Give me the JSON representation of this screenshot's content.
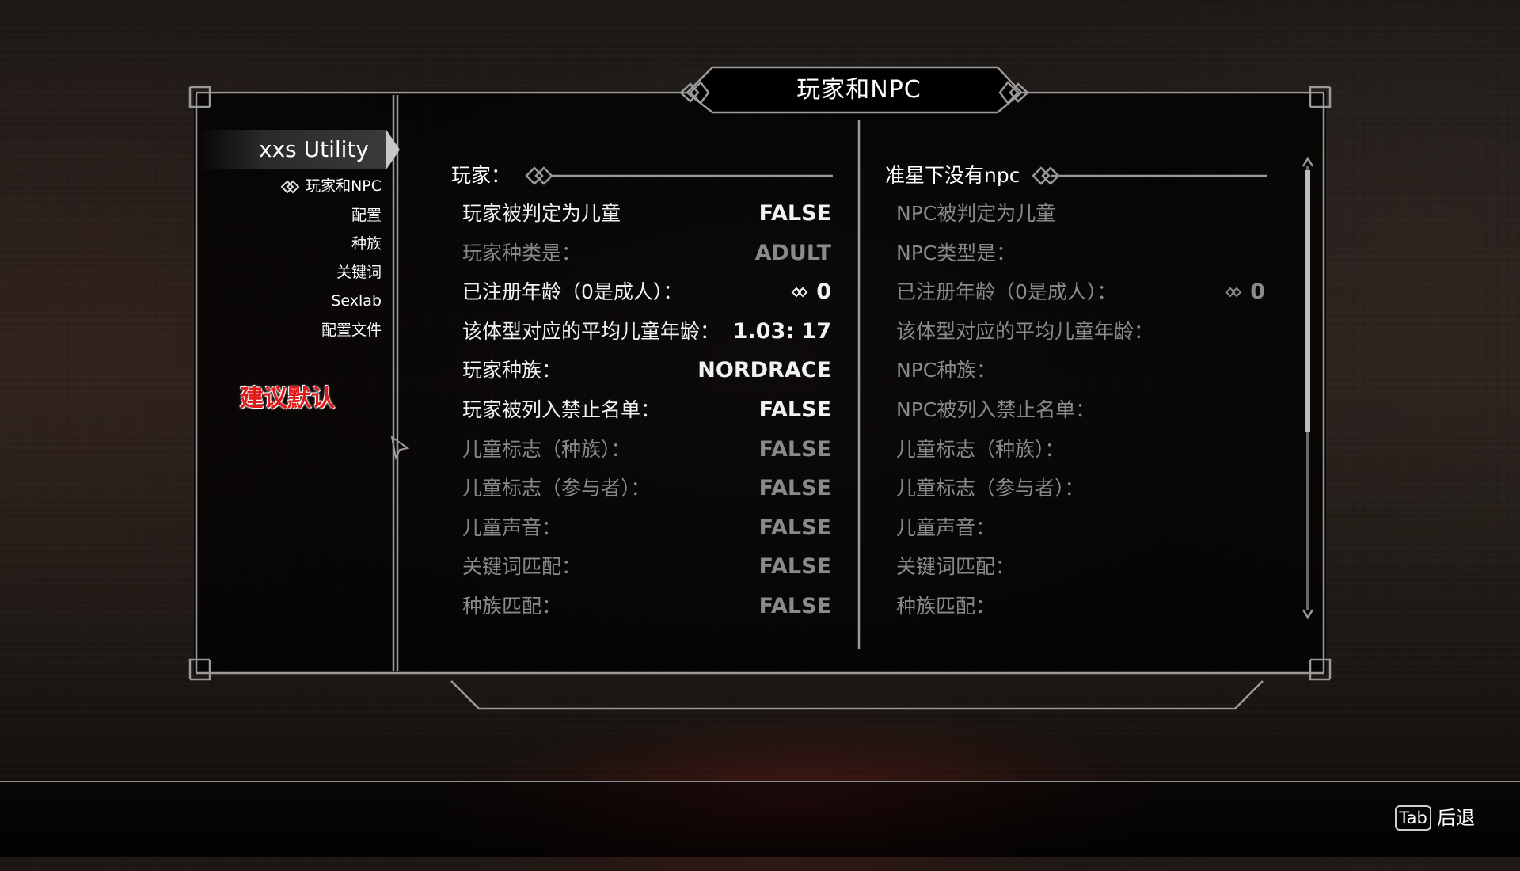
{
  "header": {
    "title": "玩家和NPC"
  },
  "sidebar": {
    "mod_title": "xxs Utility",
    "items": [
      {
        "label": "玩家和NPC",
        "selected": true
      },
      {
        "label": "配置"
      },
      {
        "label": "种族"
      },
      {
        "label": "关键词"
      },
      {
        "label": "Sexlab"
      },
      {
        "label": "配置文件"
      }
    ],
    "note": "建议默认"
  },
  "player": {
    "heading": "玩家：",
    "rows": [
      {
        "label": "玩家被判定为儿童",
        "value": "FALSE",
        "active": true
      },
      {
        "label": "玩家种类是：",
        "value": "ADULT",
        "active": false
      },
      {
        "label": "已注册年龄（0是成人）：",
        "value": "0",
        "active": true,
        "slider": true
      },
      {
        "label": "该体型对应的平均儿童年龄：",
        "value": "1.03: 17",
        "active": true
      },
      {
        "label": "玩家种族：",
        "value": "NORDRACE",
        "active": true
      },
      {
        "label": "玩家被列入禁止名单：",
        "value": "FALSE",
        "active": true
      },
      {
        "label": "儿童标志（种族）：",
        "value": "FALSE",
        "active": false
      },
      {
        "label": "儿童标志（参与者）：",
        "value": "FALSE",
        "active": false
      },
      {
        "label": "儿童声音：",
        "value": "FALSE",
        "active": false
      },
      {
        "label": "关键词匹配：",
        "value": "FALSE",
        "active": false
      },
      {
        "label": "种族匹配：",
        "value": "FALSE",
        "active": false
      }
    ]
  },
  "npc": {
    "heading": "准星下没有npc",
    "rows": [
      {
        "label": "NPC被判定为儿童",
        "value": ""
      },
      {
        "label": "NPC类型是：",
        "value": ""
      },
      {
        "label": "已注册年龄（0是成人）：",
        "value": "0",
        "slider": true
      },
      {
        "label": "该体型对应的平均儿童年龄：",
        "value": ""
      },
      {
        "label": "NPC种族：",
        "value": ""
      },
      {
        "label": "NPC被列入禁止名单：",
        "value": ""
      },
      {
        "label": "儿童标志（种族）：",
        "value": ""
      },
      {
        "label": "儿童标志（参与者）：",
        "value": ""
      },
      {
        "label": "儿童声音：",
        "value": ""
      },
      {
        "label": "关键词匹配：",
        "value": ""
      },
      {
        "label": "种族匹配：",
        "value": ""
      }
    ]
  },
  "footer": {
    "key": "Tab",
    "action": "后退"
  },
  "colors": {
    "active_text": "#f2f2f2",
    "inactive_text": "#8a8a8a",
    "note_red": "#e11b1b",
    "frame": "#9a9a9a"
  }
}
